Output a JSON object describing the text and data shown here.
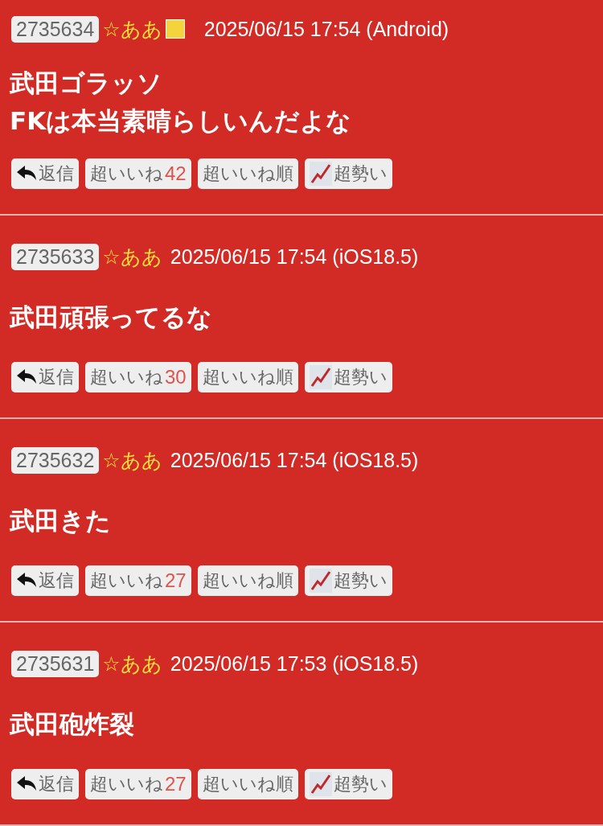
{
  "posts": [
    {
      "number": "2735634",
      "name": "☆ああ",
      "square_mark": true,
      "datetime": "2025/06/15 17:54 (Android)",
      "body": "武田ゴラッソ\nFKは本当素晴らしいんだよな",
      "reply": "返信",
      "like_label": "超いいね",
      "like_count": "42",
      "sort_label": "超いいね順",
      "trend_label": "超勢い"
    },
    {
      "number": "2735633",
      "name": "☆ああ",
      "square_mark": false,
      "datetime": "2025/06/15 17:54 (iOS18.5)",
      "body": "武田頑張ってるな",
      "reply": "返信",
      "like_label": "超いいね",
      "like_count": "30",
      "sort_label": "超いいね順",
      "trend_label": "超勢い"
    },
    {
      "number": "2735632",
      "name": "☆ああ",
      "square_mark": false,
      "datetime": "2025/06/15 17:54 (iOS18.5)",
      "body": "武田きた",
      "reply": "返信",
      "like_label": "超いいね",
      "like_count": "27",
      "sort_label": "超いいね順",
      "trend_label": "超勢い"
    },
    {
      "number": "2735631",
      "name": "☆ああ",
      "square_mark": false,
      "datetime": "2025/06/15 17:53 (iOS18.5)",
      "body": "武田砲炸裂",
      "reply": "返信",
      "like_label": "超いいね",
      "like_count": "27",
      "sort_label": "超いいね順",
      "trend_label": "超勢い"
    }
  ]
}
